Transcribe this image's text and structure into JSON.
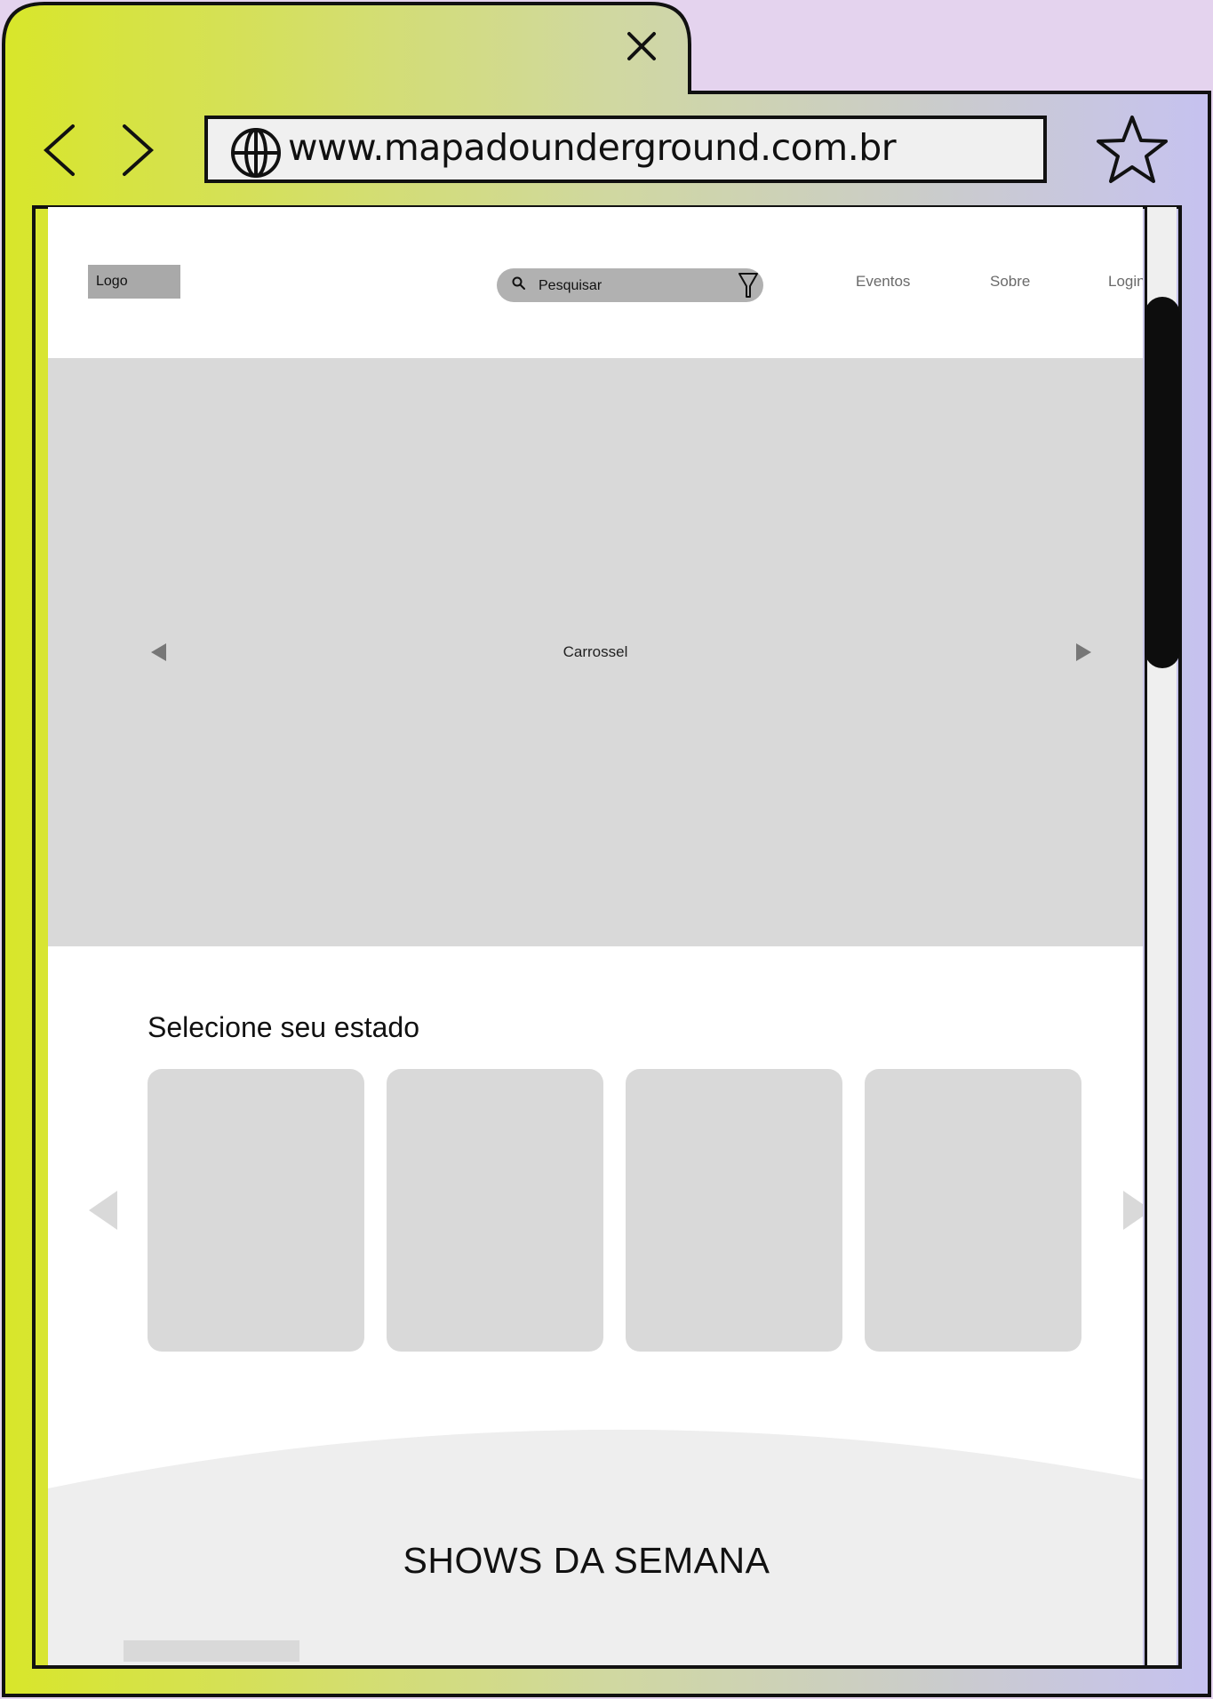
{
  "browser": {
    "url": "www.mapadounderground.com.br",
    "icons": {
      "close": "close-icon",
      "back": "chevron-left-icon",
      "forward": "chevron-right-icon",
      "globe": "globe-icon",
      "bookmark": "star-icon"
    },
    "colors": {
      "gradient_start": "#d8e62a",
      "gradient_end": "#c6c2f0",
      "outline": "#111111"
    }
  },
  "page": {
    "header": {
      "logo_label": "Logo",
      "search_placeholder": "Pesquisar",
      "nav": [
        {
          "label": "Eventos"
        },
        {
          "label": "Sobre"
        },
        {
          "label": "Login"
        }
      ]
    },
    "hero": {
      "label": "Carrossel"
    },
    "states": {
      "title": "Selecione seu estado",
      "card_count_visible": 4
    },
    "shows": {
      "title": "SHOWS DA SEMANA"
    }
  }
}
